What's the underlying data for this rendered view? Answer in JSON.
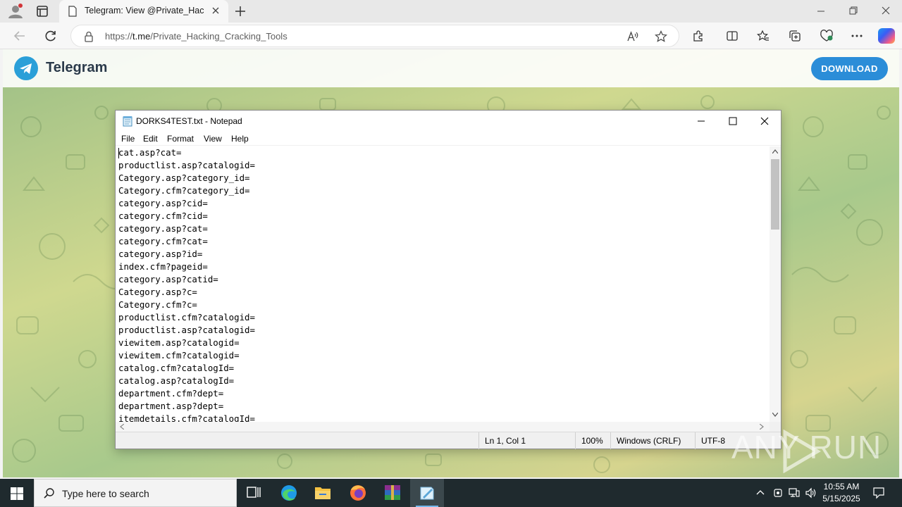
{
  "browser": {
    "tab_title": "Telegram: View @Private_Hacking_Cracking_Tools",
    "url_prefix": "https://",
    "url_domain": "t.me",
    "url_path": "/Private_Hacking_Cracking_Tools"
  },
  "telegram": {
    "brand": "Telegram",
    "download_label": "DOWNLOAD",
    "brand_color": "#2a9fd8"
  },
  "notepad": {
    "title": "DORKS4TEST.txt - Notepad",
    "menu": [
      "File",
      "Edit",
      "Format",
      "View",
      "Help"
    ],
    "lines": [
      "cat.asp?cat=",
      "productlist.asp?catalogid=",
      "Category.asp?category_id=",
      "Category.cfm?category_id=",
      "category.asp?cid=",
      "category.cfm?cid=",
      "category.asp?cat=",
      "category.cfm?cat=",
      "category.asp?id=",
      "index.cfm?pageid=",
      "category.asp?catid=",
      "Category.asp?c=",
      "Category.cfm?c=",
      "productlist.cfm?catalogid=",
      "productlist.asp?catalogid=",
      "viewitem.asp?catalogid=",
      "viewitem.cfm?catalogid=",
      "catalog.cfm?catalogId=",
      "catalog.asp?catalogId=",
      "department.cfm?dept=",
      "department.asp?dept=",
      "itemdetails.cfm?catalogId="
    ],
    "status": {
      "position": "Ln 1, Col 1",
      "zoom": "100%",
      "line_ending": "Windows (CRLF)",
      "encoding": "UTF-8"
    }
  },
  "watermark": "ANY RUN",
  "taskbar": {
    "search_placeholder": "Type here to search",
    "time": "10:55 AM",
    "date": "5/15/2025"
  }
}
